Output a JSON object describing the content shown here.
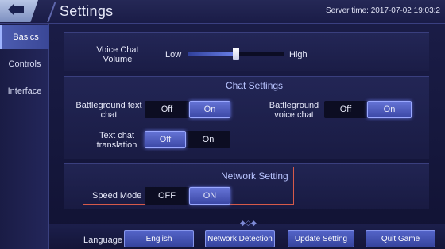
{
  "header": {
    "title": "Settings",
    "server_time": "Server time: 2017-07-02 19:03:2"
  },
  "sidebar": {
    "items": [
      {
        "label": "Basics",
        "active": true
      },
      {
        "label": "Controls",
        "active": false
      },
      {
        "label": "Interface",
        "active": false
      }
    ]
  },
  "voice_chat_volume": {
    "label_line1": "Voice Chat",
    "label_line2": "Volume",
    "low_label": "Low",
    "high_label": "High",
    "level": 0.5
  },
  "chat_settings": {
    "title": "Chat Settings",
    "battleground_text_chat": {
      "label_line1": "Battleground text",
      "label_line2": "chat",
      "off": "Off",
      "on": "On",
      "selected": "On"
    },
    "battleground_voice_chat": {
      "label_line1": "Battleground",
      "label_line2": "voice chat",
      "off": "Off",
      "on": "On",
      "selected": "On"
    },
    "text_chat_translation": {
      "label_line1": "Text chat",
      "label_line2": "translation",
      "off": "Off",
      "on": "On",
      "selected": "Off"
    }
  },
  "network_setting": {
    "title": "Network Setting",
    "speed_mode": {
      "label": "Speed Mode",
      "off": "OFF",
      "on": "ON",
      "selected": "ON"
    }
  },
  "footer": {
    "language_label": "Language",
    "language_button": "English",
    "network_detection_button": "Network Detection",
    "update_setting_button": "Update Setting",
    "quit_game_button": "Quit Game"
  },
  "colors": {
    "accent": "#4c5cb0",
    "highlight_border": "#d65a4a"
  }
}
